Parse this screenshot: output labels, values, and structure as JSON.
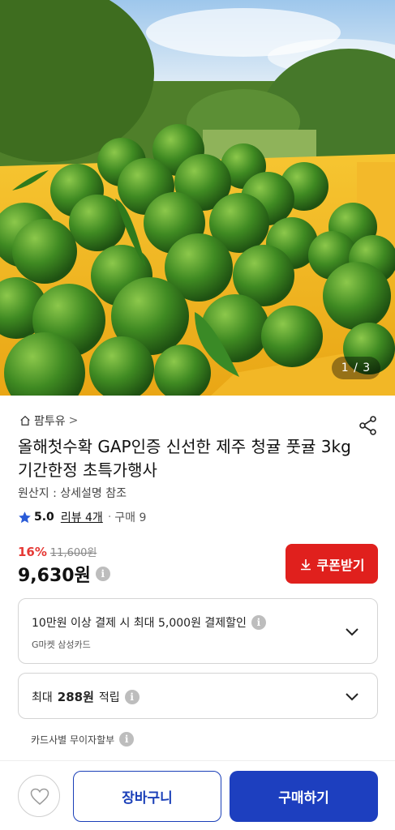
{
  "hero": {
    "counter": "1 / 3"
  },
  "product": {
    "store_name": "팜투유",
    "store_arrow": ">",
    "title": "올해첫수확 GAP인증 신선한 제주 청귤 풋귤 3kg 기간한정 초특가행사",
    "origin": "원산지 : 상세설명 참조",
    "rating": "5.0",
    "review_link": "리뷰 4개",
    "separator": "·",
    "purchase_count": "구매 9",
    "discount_rate": "16%",
    "original_price": "11,600원",
    "price": "9,630원",
    "coupon_label": "쿠폰받기"
  },
  "benefits": {
    "card_discount": "10만원 이상 결제 시 최대 5,000원 결제할인",
    "card_name": "G마켓 삼성카드",
    "points_prefix": "최대",
    "points_amount": "288원",
    "points_suffix": "적립",
    "installment": "카드사별 무이자할부"
  },
  "bottom_bar": {
    "cart_label": "장바구니",
    "buy_label": "구매하기"
  },
  "colors": {
    "coupon_red": "#e0201d",
    "discount_red": "#e53935",
    "primary_blue": "#1d3fbf",
    "star_blue": "#2a5bd7"
  },
  "icons": [
    "home-icon",
    "share-icon",
    "star-icon",
    "info-icon",
    "download-icon",
    "chevron-down-icon",
    "heart-icon"
  ]
}
